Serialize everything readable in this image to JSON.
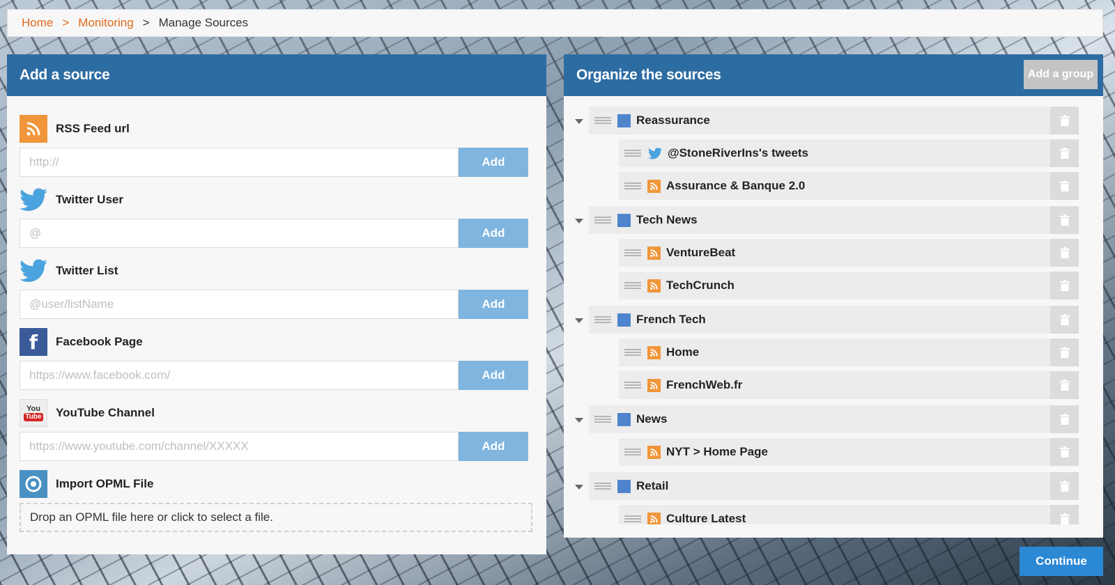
{
  "breadcrumb": {
    "items": [
      "Home",
      "Monitoring",
      "Manage Sources"
    ],
    "separator": ">"
  },
  "add_source": {
    "title": "Add a source",
    "sources": [
      {
        "label": "RSS Feed url",
        "icon": "rss-icon",
        "placeholder": "http://",
        "button": "Add"
      },
      {
        "label": "Twitter User",
        "icon": "twitter-icon",
        "placeholder": "@",
        "button": "Add"
      },
      {
        "label": "Twitter List",
        "icon": "twitter-icon",
        "placeholder": "@user/listName",
        "button": "Add"
      },
      {
        "label": "Facebook Page",
        "icon": "facebook-icon",
        "placeholder": "https://www.facebook.com/",
        "button": "Add"
      },
      {
        "label": "YouTube Channel",
        "icon": "youtube-icon",
        "placeholder": "https://www.youtube.com/channel/XXXXX",
        "button": "Add"
      }
    ],
    "opml": {
      "label": "Import OPML File",
      "icon": "opml-icon",
      "dropzone_text": "Drop an OPML file here or click to select a file."
    },
    "youtube_icon_text": {
      "you": "You",
      "tube": "Tube"
    },
    "facebook_icon_letter": "f"
  },
  "organize": {
    "title": "Organize the sources",
    "add_group_button": "Add a group",
    "groups": [
      {
        "name": "Reassurance",
        "children": [
          {
            "name": "@StoneRiverIns's tweets",
            "type": "twitter"
          },
          {
            "name": "Assurance & Banque 2.0",
            "type": "rss"
          }
        ]
      },
      {
        "name": "Tech News",
        "children": [
          {
            "name": "VentureBeat",
            "type": "rss"
          },
          {
            "name": "TechCrunch",
            "type": "rss"
          }
        ]
      },
      {
        "name": "French Tech",
        "children": [
          {
            "name": "Home",
            "type": "rss"
          },
          {
            "name": "FrenchWeb.fr",
            "type": "rss"
          }
        ]
      },
      {
        "name": "News",
        "children": [
          {
            "name": "NYT > Home Page",
            "type": "rss"
          }
        ]
      },
      {
        "name": "Retail",
        "children": [
          {
            "name": "Culture Latest",
            "type": "rss"
          }
        ]
      }
    ]
  },
  "continue_button": "Continue",
  "colors": {
    "header_blue": "#2d6ca2",
    "link_orange": "#e06a1b",
    "add_button": "#7fb5df",
    "continue_button": "#2b88d4",
    "rss_orange": "#f0963a",
    "folder_blue": "#4f84cc"
  }
}
